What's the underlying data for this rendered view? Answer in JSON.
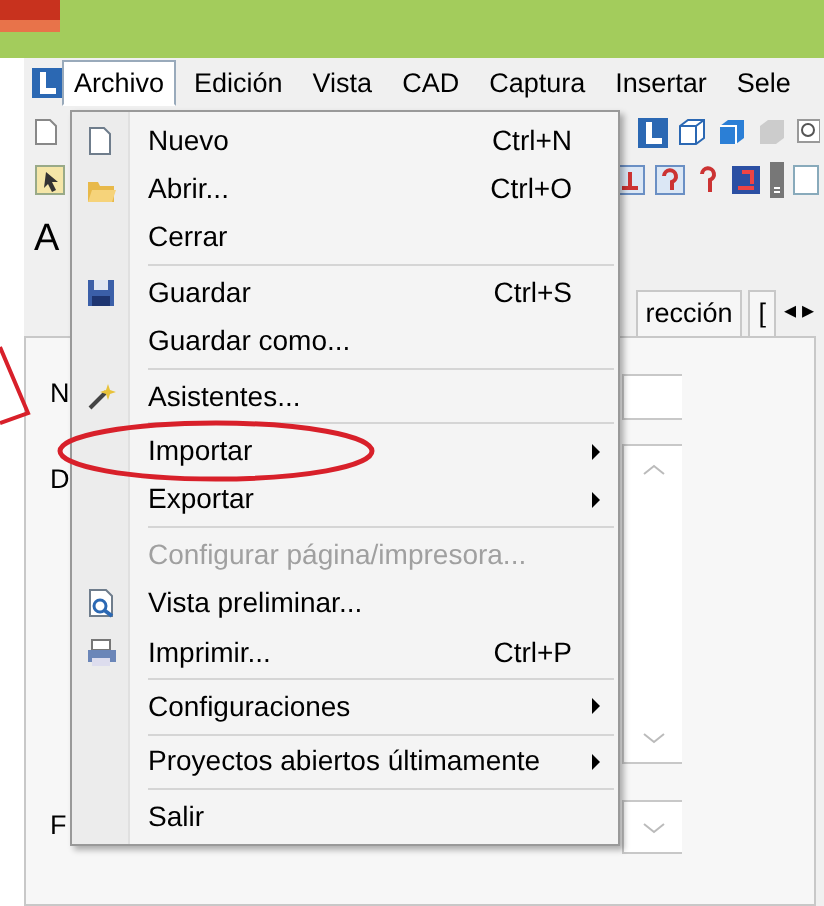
{
  "menu_bar": [
    {
      "label": "Archivo",
      "selected": true
    },
    {
      "label": "Edición",
      "selected": false
    },
    {
      "label": "Vista",
      "selected": false
    },
    {
      "label": "CAD",
      "selected": false
    },
    {
      "label": "Captura",
      "selected": false
    },
    {
      "label": "Insertar",
      "selected": false
    },
    {
      "label": "Sele",
      "selected": false
    }
  ],
  "side_label": "A",
  "tabs": [
    {
      "label": "rección"
    },
    {
      "label": "["
    }
  ],
  "tab_scroll": [
    "◂",
    "▸"
  ],
  "form_labels": [
    "N",
    "D",
    "F"
  ],
  "file_menu": [
    {
      "kind": "item",
      "label": "Nuevo",
      "shortcut": "Ctrl+N",
      "disabled": false,
      "submenu": false,
      "highlighted": false
    },
    {
      "kind": "item",
      "label": "Abrir...",
      "shortcut": "Ctrl+O",
      "disabled": false,
      "submenu": false,
      "highlighted": false
    },
    {
      "kind": "item",
      "label": "Cerrar",
      "disabled": false,
      "submenu": false,
      "highlighted": false
    },
    {
      "kind": "separator"
    },
    {
      "kind": "item",
      "label": "Guardar",
      "shortcut": "Ctrl+S",
      "disabled": false,
      "submenu": false,
      "highlighted": false
    },
    {
      "kind": "item",
      "label": "Guardar como...",
      "disabled": false,
      "submenu": false,
      "highlighted": false
    },
    {
      "kind": "separator"
    },
    {
      "kind": "item",
      "label": "Asistentes...",
      "disabled": false,
      "submenu": false,
      "highlighted": false
    },
    {
      "kind": "separator"
    },
    {
      "kind": "item",
      "label": "Importar",
      "disabled": false,
      "submenu": true,
      "highlighted": true
    },
    {
      "kind": "item",
      "label": "Exportar",
      "disabled": false,
      "submenu": true,
      "highlighted": false
    },
    {
      "kind": "separator"
    },
    {
      "kind": "item",
      "label": "Configurar página/impresora...",
      "disabled": true,
      "submenu": false,
      "highlighted": false
    },
    {
      "kind": "item",
      "label": "Vista preliminar...",
      "disabled": false,
      "submenu": false,
      "highlighted": false
    },
    {
      "kind": "item",
      "label": "Imprimir...",
      "shortcut": "Ctrl+P",
      "disabled": false,
      "submenu": false,
      "highlighted": false
    },
    {
      "kind": "separator"
    },
    {
      "kind": "item",
      "label": "Configuraciones",
      "disabled": false,
      "submenu": true,
      "highlighted": false
    },
    {
      "kind": "separator"
    },
    {
      "kind": "item",
      "label": "Proyectos abiertos últimamente",
      "disabled": false,
      "submenu": true,
      "highlighted": false
    },
    {
      "kind": "separator"
    },
    {
      "kind": "item",
      "label": "Salir",
      "disabled": false,
      "submenu": false,
      "highlighted": false
    }
  ]
}
